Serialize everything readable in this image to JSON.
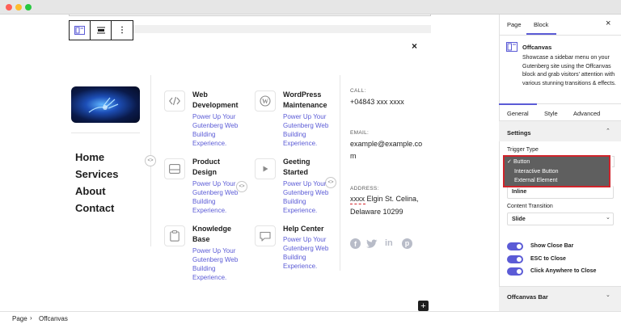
{
  "window": {
    "dots": [
      "#ff5f57",
      "#febc2e",
      "#28c840"
    ]
  },
  "toolbar": {
    "block_icon": "offcanvas-block-icon",
    "align_icon": "align-icon",
    "more_icon": "more-options-icon"
  },
  "canvas": {
    "close_glyph": "×",
    "add_glyph": "+",
    "menu": [
      "Home",
      "Services",
      "About",
      "Contact"
    ],
    "services": [
      {
        "title": "Web Development",
        "desc": "Power Up Your Gutenberg Web Building Experience.",
        "icon": "code-icon"
      },
      {
        "title": "WordPress Maintenance",
        "desc": "Power Up Your Gutenberg Web Building Experience.",
        "icon": "wordpress-icon"
      },
      {
        "title": "Product Design",
        "desc": "Power Up Your Gutenberg Web Building Experience.",
        "icon": "layout-icon"
      },
      {
        "title": "Geeting Started",
        "desc": "Power Up Your Gutenberg Web Building Experience.",
        "icon": "play-icon"
      },
      {
        "title": "Knowledge Base",
        "desc": "Power Up Your Gutenberg Web Building Experience.",
        "icon": "clipboard-icon"
      },
      {
        "title": "Help Center",
        "desc": "Power Up Your Gutenberg Web Building Experience.",
        "icon": "chat-icon"
      }
    ],
    "contact": {
      "call_label": "CALL:",
      "call_value": "+04843 xxx xxxx",
      "email_label": "EMAIL:",
      "email_value": "example@example.com",
      "address_label": "ADDRESS:",
      "address_line1": "xxxx Elgin St. Celina,",
      "address_line2": "Delaware 10299"
    },
    "social": [
      "facebook-icon",
      "twitter-icon",
      "linkedin-icon",
      "pinterest-icon"
    ]
  },
  "sidebar": {
    "tabs": [
      "Page",
      "Block"
    ],
    "active_tab": "Block",
    "close_glyph": "×",
    "block_name": "Offcanvas",
    "block_desc": "Showcase a sidebar menu on your Gutenberg site using the Offcanvas block and grab visitors' attention with various stunning transitions & effects.",
    "sub_tabs": [
      "General",
      "Style",
      "Advanced"
    ],
    "active_sub_tab": "General",
    "settings_title": "Settings",
    "trigger_type_label": "Trigger Type",
    "trigger_options": [
      "Button",
      "Interactive Button",
      "External Element"
    ],
    "trigger_selected": "Button",
    "checkmark": "✓",
    "position_value": "Inline",
    "content_transition_label": "Content Transition",
    "content_transition_value": "Slide",
    "toggles": [
      "Show Close Bar",
      "ESC to Close",
      "Click Anywhere to Close"
    ],
    "offcanvas_bar_title": "Offcanvas Bar"
  },
  "statusbar": {
    "crumbs": [
      "Page",
      "Offcanvas"
    ],
    "separator": "›"
  },
  "colors": {
    "accent": "#5b5bd6",
    "highlight_border": "#d0242b",
    "dropdown_bg": "#5f5f5f"
  }
}
